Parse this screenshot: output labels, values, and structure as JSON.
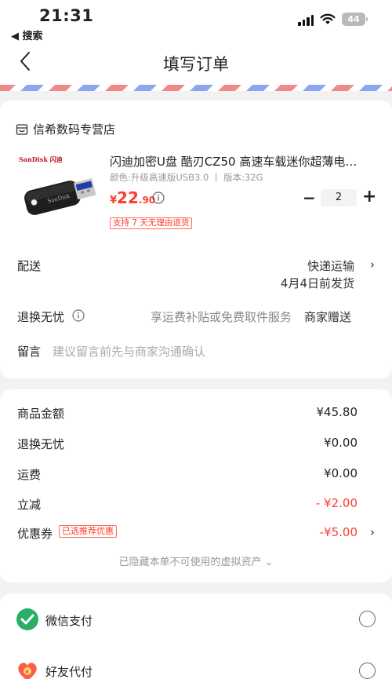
{
  "status_bar": {
    "time": "21:31",
    "back_app": "◀ 搜索",
    "battery": "44"
  },
  "nav": {
    "back_icon": "chevron-left-icon",
    "title": "填写订单"
  },
  "order": {
    "store_name": "信希数码专营店",
    "product": {
      "brand_text": "SanDisk 闪迪",
      "title": "闪迪加密U盘 酷刃CZ50 高速车载迷你超薄电…",
      "spec": "颜色:升级高速版USB3.0 丨 版本:32G",
      "price_currency": "¥",
      "price_int": "22",
      "price_dec": ".90",
      "quantity": "2",
      "return_badge": "支持 7 天无理由退货"
    },
    "delivery": {
      "label": "配送",
      "method": "快递运输",
      "date": "4月4日前发货"
    },
    "worry_free": {
      "label": "退换无忧",
      "desc": "享运费补贴或免费取件服务",
      "value": "商家赠送"
    },
    "message": {
      "label": "留言",
      "placeholder": "建议留言前先与商家沟通确认"
    }
  },
  "summary": {
    "items": [
      {
        "label": "商品金额",
        "value": "¥45.80"
      },
      {
        "label": "退换无忧",
        "value": "¥0.00"
      },
      {
        "label": "运费",
        "value": "¥0.00"
      },
      {
        "label": "立减",
        "value": "- ¥2.00"
      },
      {
        "label": "优惠券",
        "value": "-¥5.00"
      }
    ],
    "coupon_badge": "已选推荐优惠",
    "hidden_note": "已隐藏本单不可使用的虚拟资产 ⌄"
  },
  "payment": {
    "options": [
      {
        "label": "微信支付",
        "icon": "wechat-pay-icon"
      },
      {
        "label": "好友代付",
        "icon": "friend-pay-icon"
      }
    ]
  },
  "colors": {
    "accent_red": "#ff3b2f",
    "wechat_green": "#2aae67",
    "airmail_red": "#f08a8a",
    "airmail_blue": "#8aa6ef"
  }
}
